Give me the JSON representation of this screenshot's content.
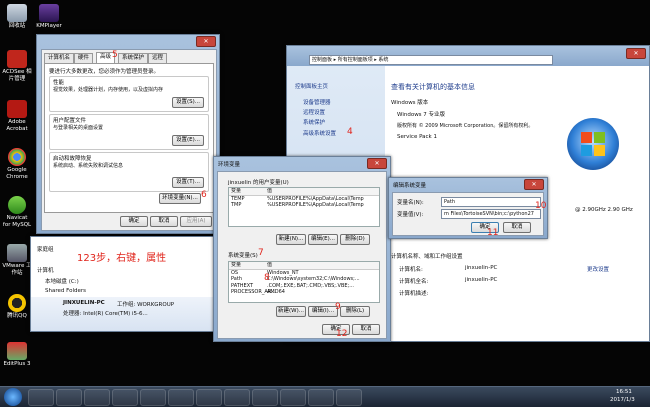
{
  "desktop": {
    "icons": [
      {
        "label": "回收站"
      },
      {
        "label": "KMPlayer"
      },
      {
        "label": "ACDSee 相片管理"
      },
      {
        "label": "Adobe Acrobat"
      },
      {
        "label": "Google Chrome"
      },
      {
        "label": "Navicat for MySQL"
      },
      {
        "label": "VMware 工作站"
      },
      {
        "label": "腾讯QQ"
      },
      {
        "label": "EditPlus 3"
      }
    ]
  },
  "annotations": {
    "step123": "123步，右键，属性",
    "n4": "4",
    "n5": "5",
    "n6": "6",
    "n7": "7",
    "n8": "8",
    "n9": "9",
    "n10": "10",
    "n11": "11",
    "n12": "12"
  },
  "system_window": {
    "address": "控制面板 ▸ 所有控制面板项 ▸ 系统",
    "nav": [
      "控制面板主页",
      "设备管理器",
      "远程设置",
      "系统保护",
      "高级系统设置"
    ],
    "heading": "查看有关计算机的基本信息",
    "windows_edition_title": "Windows 版本",
    "edition": "Windows 7 专业版",
    "copyright": "版权所有 © 2009 Microsoft Corporation。保留所有权利。",
    "sp": "Service Pack 1",
    "cpu_speed": "@ 2.90GHz   2.90 GHz",
    "section2": "计算机名称、域和工作组设置",
    "computer_name_label": "计算机名:",
    "computer_name": "jinxuelin-PC",
    "full_name_label": "计算机全名:",
    "full_name": "jinxuelin-PC",
    "desc_label": "计算机描述:",
    "change_settings": "更改设置"
  },
  "sysprops": {
    "tabs": [
      "计算机名",
      "硬件",
      "高级",
      "系统保护",
      "远程"
    ],
    "notice": "要进行大多数更改，您必须作为管理员登录。",
    "perf_title": "性能",
    "perf_desc": "视觉效果，处理器计划，内存使用，以及虚拟内存",
    "profile_title": "用户配置文件",
    "profile_desc": "与登录相关的桌面设置",
    "startup_title": "启动和故障恢复",
    "startup_desc": "系统启动、系统失败和调试信息",
    "settings_btn": "设置(S)...",
    "settings_btn2": "设置(E)...",
    "settings_btn3": "设置(T)...",
    "env_btn": "环境变量(N)...",
    "ok": "确定",
    "cancel": "取消",
    "apply": "应用(A)"
  },
  "envvars": {
    "title": "环境变量",
    "user_group": "jinxuelin 的用户变量(U)",
    "col_var": "变量",
    "col_val": "值",
    "user_rows": [
      {
        "var": "TEMP",
        "val": "%USERPROFILE%\\AppData\\Local\\Temp"
      },
      {
        "var": "TMP",
        "val": "%USERPROFILE%\\AppData\\Local\\Temp"
      }
    ],
    "sys_group": "系统变量(S)",
    "sys_rows": [
      {
        "var": "OS",
        "val": "Windows_NT"
      },
      {
        "var": "Path",
        "val": "C:\\Windows\\system32;C:\\Windows;..."
      },
      {
        "var": "PATHEXT",
        "val": ".COM;.EXE;.BAT;.CMD;.VBS;.VBE;..."
      },
      {
        "var": "PROCESSOR_AR...",
        "val": "AMD64"
      }
    ],
    "new_btn": "新建(N)...",
    "edit_btn": "编辑(E)...",
    "delete_btn": "删除(D)",
    "new_btn2": "新建(W)...",
    "edit_btn2": "编辑(I)...",
    "delete_btn2": "删除(L)",
    "ok": "确定",
    "cancel": "取消"
  },
  "editvar": {
    "title": "编辑系统变量",
    "name_label": "变量名(N):",
    "name_value": "Path",
    "value_label": "变量值(V):",
    "value_value": "m Files\\TortoiseSVN\\bin;c:\\python27",
    "ok": "确定",
    "cancel": "取消"
  },
  "explorer": {
    "homegroup": "家庭组",
    "computer": "计算机",
    "local_disk": "本地磁盘 (C:)",
    "shared": "Shared Folders",
    "pc_name": "JINXUELIN-PC",
    "workgroup": "工作组: WORKGROUP",
    "processor": "处理器: Intel(R) Core(TM) i5-6..."
  },
  "taskbar": {
    "time": "16:51",
    "date": "2017/1/3"
  },
  "colors": {
    "accent": "#e0241b",
    "aero": "#a9c2de",
    "title_blue": "#1e3c8c"
  }
}
